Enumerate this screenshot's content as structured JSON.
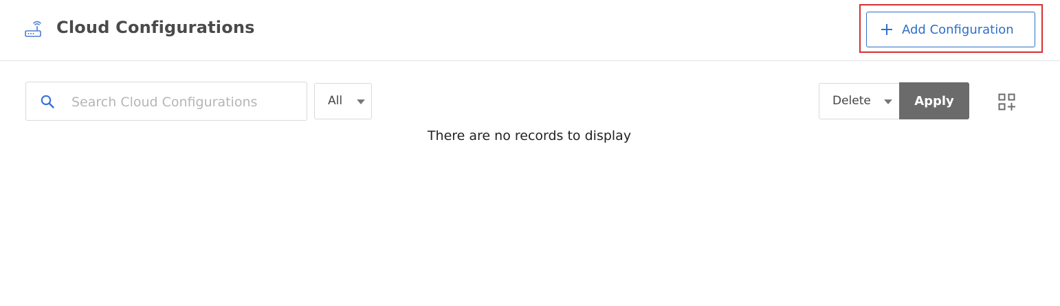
{
  "header": {
    "title": "Cloud Configurations",
    "icon": "router-wifi-icon",
    "add_button_label": "Add Configuration",
    "add_button_icon": "plus-icon",
    "accent_color": "#2d6fc6",
    "highlight_color": "#d32f2f"
  },
  "toolbar": {
    "search": {
      "placeholder": "Search Cloud Configurations",
      "value": "",
      "icon": "search-icon"
    },
    "filter": {
      "selected": "All"
    },
    "bulk_action": {
      "selected": "Delete",
      "apply_label": "Apply",
      "apply_color": "#6b6b6b"
    },
    "view_toggle_icon": "grid-add-icon"
  },
  "table": {
    "empty_message": "There are no records to display"
  }
}
